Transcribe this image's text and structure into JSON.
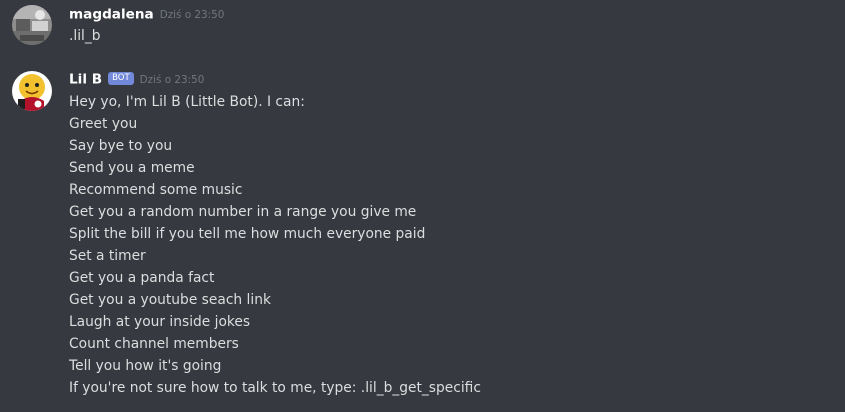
{
  "messages": {
    "user": {
      "avatar_icon": "user-avatar-icon",
      "username": "magdalena",
      "timestamp": "Dziś o 23:50",
      "lines": [
        ".lil_b"
      ]
    },
    "bot": {
      "avatar_icon": "bot-avatar-icon",
      "username": "Lil B",
      "bot_tag": "BOT",
      "timestamp": "Dziś o 23:50",
      "lines": [
        "Hey yo, I'm Lil B (Little Bot). I can:",
        "Greet you",
        "Say bye to you",
        "Send you a meme",
        "Recommend some music",
        "Get you a random number in a range you give me",
        "Split the bill if you tell me how much everyone paid",
        "Set a timer",
        "Get you a panda fact",
        "Get you a youtube seach link",
        "Laugh at your inside jokes",
        "Count channel members",
        "Tell you how it's going",
        "If you're not sure how to talk to me, type: .lil_b_get_specific"
      ]
    }
  },
  "colors": {
    "background": "#36393f",
    "text": "#dcddde",
    "username": "#ffffff",
    "timestamp": "#72767d",
    "bot_tag": "#7289da"
  }
}
